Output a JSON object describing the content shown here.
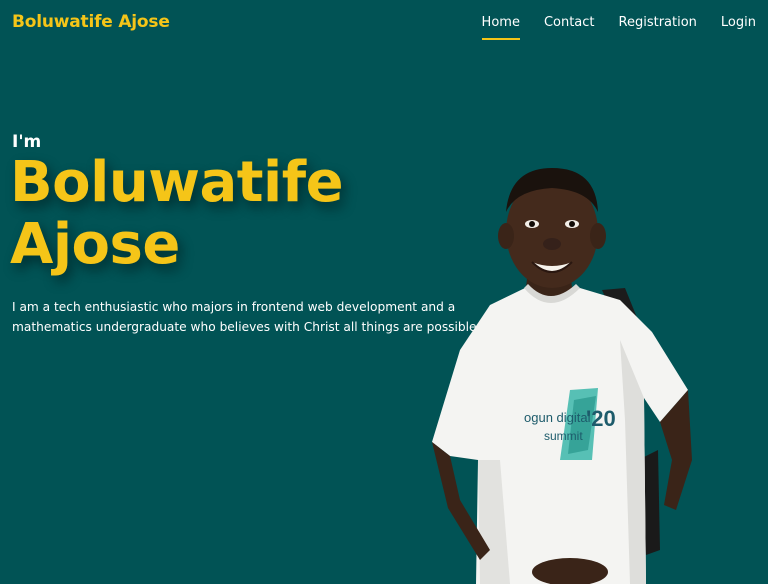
{
  "nav": {
    "brand": "Boluwatife Ajose",
    "links": [
      {
        "label": "Home",
        "active": true
      },
      {
        "label": "Contact",
        "active": false
      },
      {
        "label": "Registration",
        "active": false
      },
      {
        "label": "Login",
        "active": false
      }
    ]
  },
  "hero": {
    "intro": "I'm",
    "name_line1": "Boluwatife",
    "name_line2": "Ajose",
    "description": "I am a tech enthusiastic who majors in frontend web development and a mathematics undergraduate who believes with Christ all things are possible."
  },
  "portrait": {
    "shirt_text_1": "ogun digital",
    "shirt_text_2": "summit",
    "shirt_text_3": "'20"
  },
  "colors": {
    "background": "#015355",
    "accent": "#f5c518",
    "text": "#ffffff"
  }
}
